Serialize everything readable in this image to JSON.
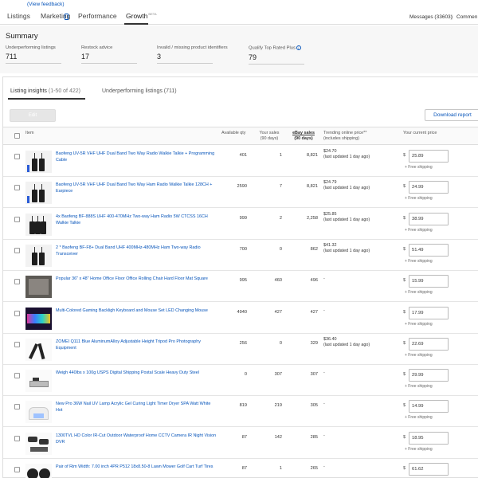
{
  "feedback_link": "(View feedback)",
  "nav": {
    "tabs": [
      "Listings",
      "Marketing",
      "Performance",
      "Growth"
    ],
    "growth_badge": "BETA",
    "messages": "Messages (33603)",
    "comments": "Commen"
  },
  "summary": {
    "title": "Summary",
    "metrics": [
      {
        "label": "Underperforming listings",
        "value": "711"
      },
      {
        "label": "Restock advice",
        "value": "17"
      },
      {
        "label": "Invalid / missing product identifiers",
        "value": "3"
      },
      {
        "label": "Qualify Top Rated Plus",
        "value": "79"
      }
    ]
  },
  "tabs": {
    "insights_label": "Listing insights",
    "insights_count": "(1-50 of 422)",
    "underperforming": "Underperforming listings (711)"
  },
  "actions": {
    "edit": "Edit",
    "download": "Download report"
  },
  "columns": {
    "item": "Item",
    "available_qty": "Available qty",
    "your_sales_1": "Your sales",
    "your_sales_2": "(90 days)",
    "ebay_sales_1": "eBay sales",
    "ebay_sales_2": "(90 days)",
    "trending_1": "Trending online price**",
    "trending_2": "(includes shipping)",
    "current_price": "Your current price"
  },
  "currency": "$",
  "free_shipping": "+ Free shipping",
  "rows": [
    {
      "title": "Baofeng UV-5R VHF UHF Dual Band Two Way Radio Walkie Talkie + Programming Cable",
      "qty": "401",
      "your_sales": "1",
      "ebay_sales": "8,821",
      "trend_price": "$24.70",
      "trend_note": "(last updated 1 day ago)",
      "price": "25.89"
    },
    {
      "title": "Baofeng UV-5R VHF UHF Dual Band Two Way Ham Radio Walkie Talkie 128CH + Earpiece",
      "qty": "2590",
      "your_sales": "7",
      "ebay_sales": "8,821",
      "trend_price": "$24.79",
      "trend_note": "(last updated 1 day ago)",
      "price": "24.99"
    },
    {
      "title": "4x Baofeng BF-888S UHF 400-470MHz Two-way Ham Radio 5W CTCSS 16CH Walkie Talkie",
      "qty": "999",
      "your_sales": "2",
      "ebay_sales": "2,258",
      "trend_price": "$25.85",
      "trend_note": "(last updated 1 day ago)",
      "price": "38.99"
    },
    {
      "title": "2 * Baofeng BF-F8+ Dual Band UHF 400MHz-480MHz Ham Two-way Radio Transceiver",
      "qty": "700",
      "your_sales": "0",
      "ebay_sales": "862",
      "trend_price": "$41.32",
      "trend_note": "(last updated 1 day ago)",
      "price": "51.49"
    },
    {
      "title": "Popular 36\" x 48\" Home Office Floor Office Rolling Chair Hard Floor Mat Square",
      "qty": "995",
      "your_sales": "460",
      "ebay_sales": "496",
      "trend_price": "-",
      "trend_note": "",
      "price": "15.99"
    },
    {
      "title": "Multi-Colored Gaming Backligh Keyboard and Mouse Set LED Changing Mouse",
      "qty": "4940",
      "your_sales": "427",
      "ebay_sales": "427",
      "trend_price": "-",
      "trend_note": "",
      "price": "17.99"
    },
    {
      "title": "ZOMEI Q111 Blue AluminumAlloy Adjustable Height Tripod Pro Photography Equipment",
      "qty": "256",
      "your_sales": "0",
      "ebay_sales": "329",
      "trend_price": "$36.40",
      "trend_note": "(last updated 1 day ago)",
      "price": "22.69"
    },
    {
      "title": "Weigh 440lbs x 100g USPS Digital Shipping Postal Scale Heavy Duty Steel",
      "qty": "0",
      "your_sales": "307",
      "ebay_sales": "307",
      "trend_price": "-",
      "trend_note": "",
      "price": "29.99"
    },
    {
      "title": "New Pro 36W Nail UV Lamp Acrylic Gel Curing Light Timer Dryer SPA Watt White Hot",
      "qty": "819",
      "your_sales": "219",
      "ebay_sales": "305",
      "trend_price": "-",
      "trend_note": "",
      "price": "14.99"
    },
    {
      "title": "1300TVL HD Color IR-Cut Outdoor Waterproof Home CCTV Camera IR Night Vision DVR",
      "qty": "87",
      "your_sales": "142",
      "ebay_sales": "285",
      "trend_price": "-",
      "trend_note": "",
      "price": "18.95"
    },
    {
      "title": "Pair of Rim Width: 7.00 inch 4PR P512 18x8.50-8 Lawn Mower Golf Cart Turf Tires",
      "qty": "87",
      "your_sales": "1",
      "ebay_sales": "265",
      "trend_price": "-",
      "trend_note": "",
      "price": "61.62"
    }
  ]
}
